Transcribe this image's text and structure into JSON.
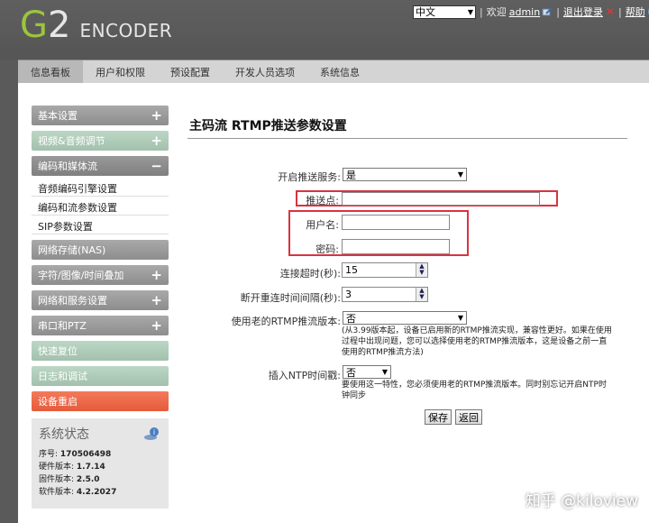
{
  "header": {
    "logo_g": "G",
    "logo_2": "2",
    "logo_encoder": "ENCODER",
    "language": "中文",
    "welcome": "欢迎",
    "user": "admin",
    "logout": "退出登录",
    "help": "帮助"
  },
  "tabs": [
    "信息看板",
    "用户和权限",
    "预设配置",
    "开发人员选项",
    "系统信息"
  ],
  "sidebar": {
    "items": {
      "basic": "基本设置",
      "video_audio": "视频&音频调节",
      "encode_stream": "编码和媒体流",
      "sub": [
        "音频编码引擎设置",
        "编码和流参数设置",
        "SIP参数设置"
      ],
      "nas": "网络存储(NAS)",
      "osd": "字符/图像/时间叠加",
      "network": "网络和服务设置",
      "serial": "串口和PTZ",
      "quick_reset": "快速复位",
      "log": "日志和调试",
      "reboot": "设备重启"
    },
    "status": {
      "title": "系统状态",
      "serial_label": "序号:",
      "serial": "170506498",
      "hw_label": "硬件版本:",
      "hw": "1.7.14",
      "fw_label": "固件版本:",
      "fw": "2.5.0",
      "sw_label": "软件版本:",
      "sw": "4.2.2027"
    }
  },
  "main": {
    "title": "主码流 RTMP推送参数设置",
    "enable_label": "开启推送服务:",
    "enable_value": "是",
    "push_label": "推送点:",
    "push_value": "",
    "username_label": "用户名:",
    "username_value": "",
    "password_label": "密码:",
    "password_value": "",
    "timeout_label": "连接超时(秒):",
    "timeout_value": "15",
    "reconnect_label": "断开重连时间间隔(秒):",
    "reconnect_value": "3",
    "old_rtmp_label": "使用老的RTMP推流版本:",
    "old_rtmp_value": "否",
    "old_rtmp_note_1": "(从3.99版本起，设备已启用新的RTMP推流实现，兼容性更好。如果在使用",
    "old_rtmp_note_2": "过程中出现问题，您可以选择使用老的RTMP推流版本，这是设备之前一直",
    "old_rtmp_note_3": "使用的RTMP推流方法)",
    "ntp_label": "插入NTP时间戳:",
    "ntp_value": "否",
    "ntp_note_1": "要使用这一特性，您必须使用老的RTMP推流版本。同时别忘记开启NTP时",
    "ntp_note_2": "钟同步",
    "save": "保存",
    "back": "返回"
  },
  "watermark": "知乎 @kiloview",
  "colors": {
    "highlight": "#d9333f",
    "logo_green": "#9bc53d",
    "reboot": "#e55a3a"
  }
}
